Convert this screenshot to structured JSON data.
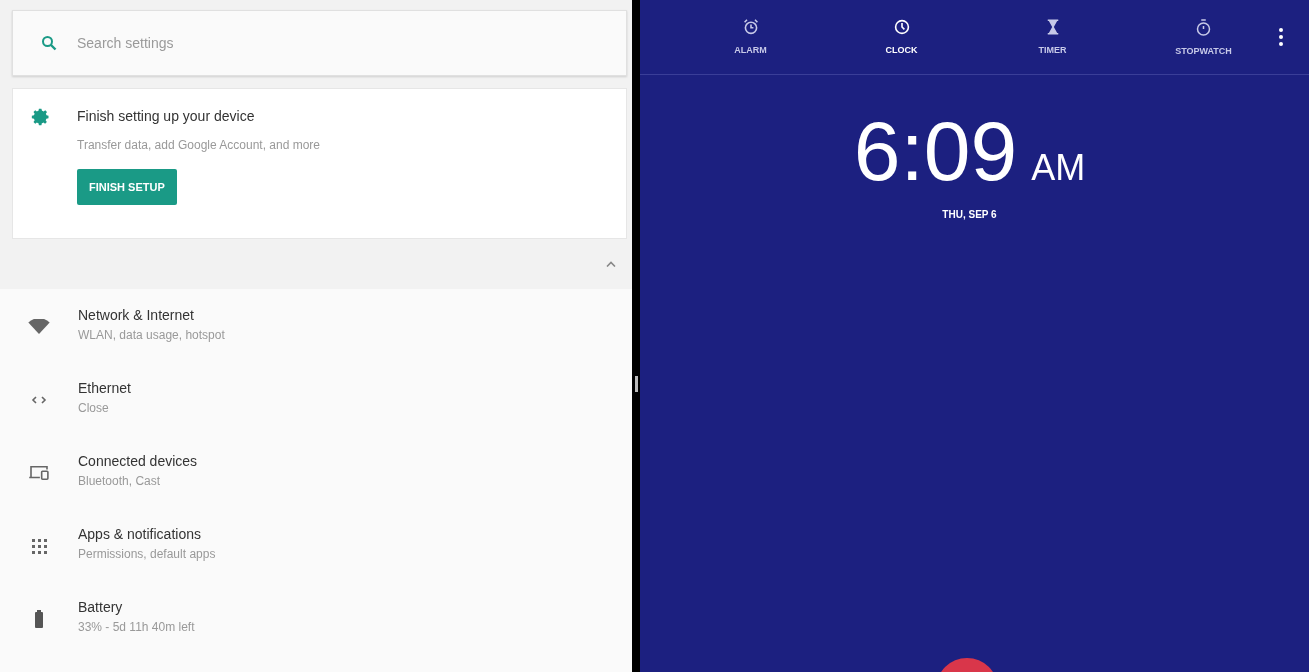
{
  "search": {
    "placeholder": "Search settings"
  },
  "setup_card": {
    "title": "Finish setting up your device",
    "subtitle": "Transfer data, add Google Account, and more",
    "button": "FINISH SETUP"
  },
  "settings": [
    {
      "kind": "wifi",
      "title": "Network & Internet",
      "subtitle": "WLAN, data usage, hotspot"
    },
    {
      "kind": "ethernet",
      "title": "Ethernet",
      "subtitle": "Close"
    },
    {
      "kind": "devices",
      "title": "Connected devices",
      "subtitle": "Bluetooth, Cast"
    },
    {
      "kind": "apps",
      "title": "Apps & notifications",
      "subtitle": "Permissions, default apps"
    },
    {
      "kind": "battery",
      "title": "Battery",
      "subtitle": "33% - 5d 11h 40m left"
    }
  ],
  "clock_tabs": [
    {
      "kind": "alarm",
      "label": "ALARM",
      "selected": false
    },
    {
      "kind": "clock",
      "label": "CLOCK",
      "selected": true
    },
    {
      "kind": "timer",
      "label": "TIMER",
      "selected": false
    },
    {
      "kind": "stopwatch",
      "label": "STOPWATCH",
      "selected": false
    }
  ],
  "time": "6:09",
  "ampm": "AM",
  "date": "THU, SEP 6"
}
